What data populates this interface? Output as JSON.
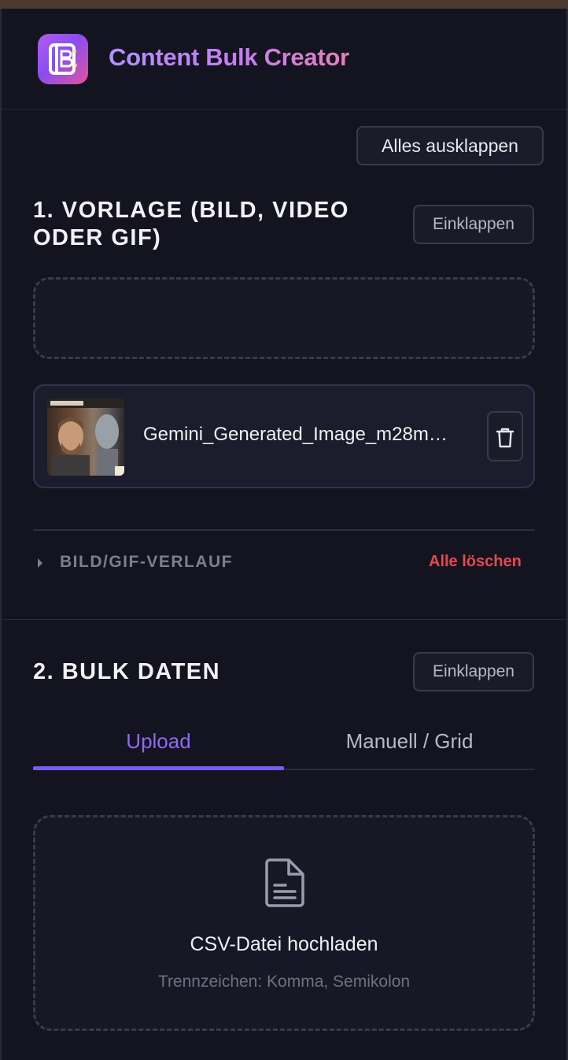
{
  "app": {
    "title": "Content Bulk Creator",
    "logo_icon": "book-b-logo",
    "colors": {
      "accent": "#7b5cf0",
      "danger": "#e5484d",
      "background": "#141420"
    }
  },
  "toolbar": {
    "expand_all_label": "Alles ausklappen"
  },
  "section_template": {
    "title": "1. VORLAGE (BILD, VIDEO ODER GIF)",
    "collapse_label": "Einklappen",
    "file": {
      "name": "Gemini_Generated_Image_m28m…",
      "delete_icon": "trash-icon"
    },
    "history": {
      "label": "BILD/GIF-VERLAUF",
      "clear_label": "Alle löschen"
    }
  },
  "section_bulk": {
    "title": "2. BULK DATEN",
    "collapse_label": "Einklappen",
    "tabs": [
      {
        "label": "Upload",
        "active": true
      },
      {
        "label": "Manuell / Grid",
        "active": false
      }
    ],
    "csv": {
      "icon": "file-text-icon",
      "title": "CSV-Datei hochladen",
      "hint": "Trennzeichen: Komma, Semikolon"
    }
  }
}
